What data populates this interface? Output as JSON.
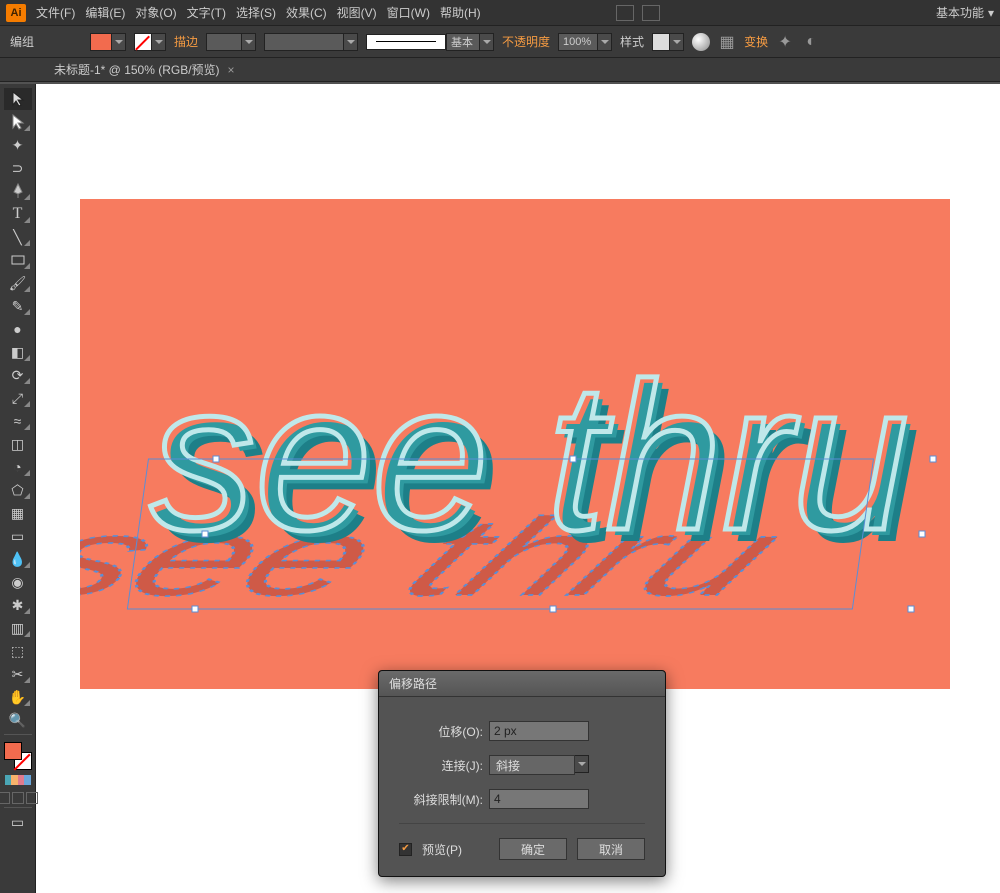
{
  "app": {
    "logo_text": "Ai"
  },
  "menu": {
    "items": [
      "文件(F)",
      "编辑(E)",
      "对象(O)",
      "文字(T)",
      "选择(S)",
      "效果(C)",
      "视图(V)",
      "窗口(W)",
      "帮助(H)"
    ],
    "workspace": "基本功能"
  },
  "options": {
    "group_label": "编组",
    "stroke_label": "描边",
    "stroke_weight": "",
    "stroke_style_label": "基本",
    "opacity_label": "不透明度",
    "opacity_value": "100%",
    "style_label": "样式",
    "transform_label": "变换",
    "fill_color": "#f26b4e"
  },
  "doc_tab": {
    "title": "未标题-1* @ 150% (RGB/预览)"
  },
  "tools": [
    "selection",
    "direct-selection",
    "wand",
    "lasso",
    "pen",
    "type",
    "line",
    "rectangle",
    "brush",
    "pencil",
    "blob",
    "eraser",
    "rotate",
    "scale",
    "width",
    "free-transform",
    "shape-builder",
    "perspective",
    "mesh",
    "gradient",
    "eyedropper",
    "blend",
    "symbol-spray",
    "graph",
    "artboard",
    "slice",
    "hand",
    "zoom"
  ],
  "color_strip": [
    "#4aa6b5",
    "#f7b36b",
    "#e07a8c",
    "#6aa6d9"
  ],
  "artwork": {
    "text_main": "see thru",
    "bg_color": "#f77b5f",
    "text_fill": "#2f9aa0",
    "text_stroke": "#bfe8ea"
  },
  "dialog": {
    "title": "偏移路径",
    "offset_label": "位移(O):",
    "offset_value": "2 px",
    "join_label": "连接(J):",
    "join_value": "斜接",
    "miter_label": "斜接限制(M):",
    "miter_value": "4",
    "preview_label": "预览(P)",
    "preview_checked": true,
    "ok": "确定",
    "cancel": "取消"
  }
}
